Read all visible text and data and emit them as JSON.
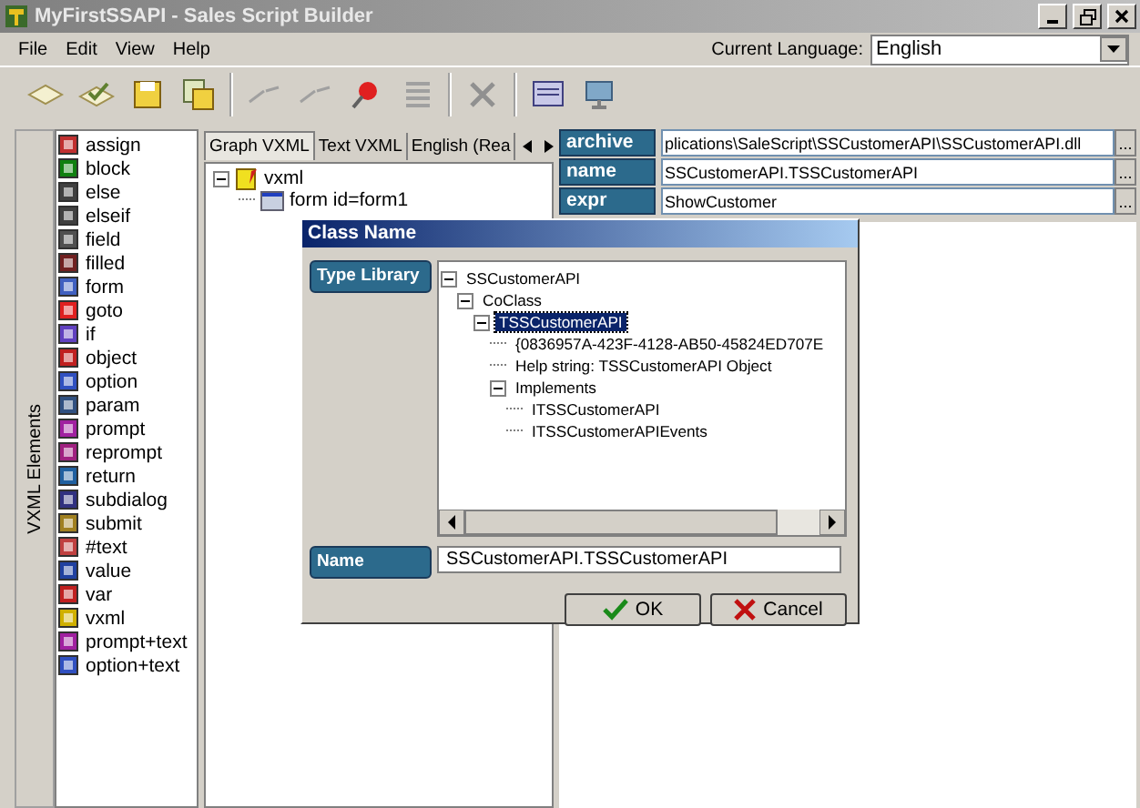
{
  "window": {
    "title": "MyFirstSSAPI - Sales Script Builder"
  },
  "menu": [
    "File",
    "Edit",
    "View",
    "Help"
  ],
  "language": {
    "label": "Current Language:",
    "value": "English"
  },
  "side_tab": "VXML Elements",
  "elements": [
    "assign",
    "block",
    "else",
    "elseif",
    "field",
    "filled",
    "form",
    "goto",
    "if",
    "object",
    "option",
    "param",
    "prompt",
    "reprompt",
    "return",
    "subdialog",
    "submit",
    "#text",
    "value",
    "var",
    "vxml",
    "prompt+text",
    "option+text"
  ],
  "tabs": [
    {
      "label": "Graph VXML",
      "selected": true
    },
    {
      "label": "Text VXML",
      "selected": false
    },
    {
      "label": "English (Rea",
      "selected": false
    }
  ],
  "tree": [
    {
      "label": "vxml",
      "expanded": true,
      "children": [
        {
          "label": "form id=form1"
        }
      ]
    }
  ],
  "properties": [
    {
      "name": "archive",
      "value": "plications\\SaleScript\\SSCustomerAPI\\SSCustomerAPI.dll",
      "button": "..."
    },
    {
      "name": "name",
      "value": "SSCustomerAPI.TSSCustomerAPI",
      "button": "..."
    },
    {
      "name": "expr",
      "value": "ShowCustomer",
      "button": "..."
    }
  ],
  "dialog": {
    "title": "Class Name",
    "type_library_label": "Type Library",
    "tree": [
      {
        "label": "SSCustomerAPI",
        "expanded": true,
        "selected": false,
        "children": [
          {
            "label": "CoClass",
            "expanded": true,
            "selected": false,
            "children": [
              {
                "label": "TSSCustomerAPI",
                "expanded": true,
                "selected": true,
                "children": [
                  {
                    "label": "{0836957A-423F-4128-AB50-45824ED707E",
                    "selected": false
                  },
                  {
                    "label": "Help string: TSSCustomerAPI Object",
                    "selected": false
                  },
                  {
                    "label": "Implements",
                    "expanded": true,
                    "selected": false,
                    "children": [
                      {
                        "label": "ITSSCustomerAPI",
                        "selected": false
                      },
                      {
                        "label": "ITSSCustomerAPIEvents",
                        "selected": false
                      }
                    ]
                  }
                ]
              }
            ]
          }
        ]
      }
    ],
    "name_label": "Name",
    "name_value": "SSCustomerAPI.TSSCustomerAPI",
    "buttons": [
      {
        "label": "OK",
        "kind": "ok"
      },
      {
        "label": "Cancel",
        "kind": "cancel"
      }
    ]
  }
}
